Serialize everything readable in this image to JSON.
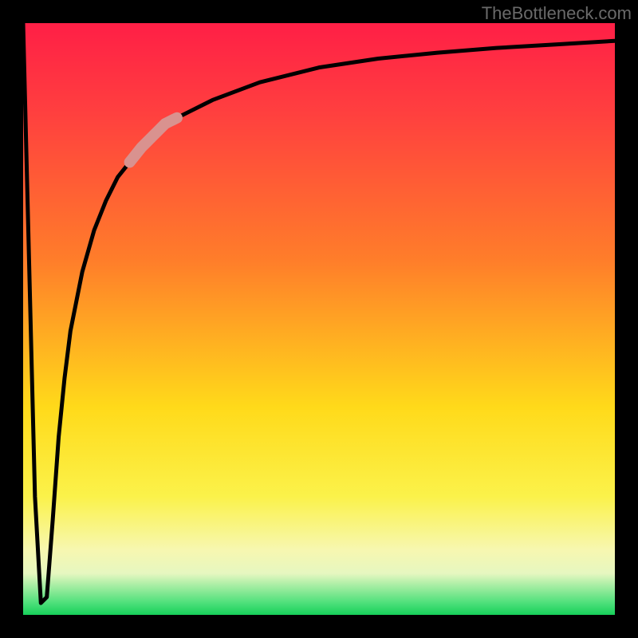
{
  "watermark": "TheBottleneck.com",
  "colors": {
    "frame": "#000000",
    "curve": "#000000",
    "highlight": "#d9928f",
    "gradient_top": "#ff1f46",
    "gradient_bottom": "#17d05a"
  },
  "chart_data": {
    "type": "line",
    "title": "",
    "xlabel": "",
    "ylabel": "",
    "xlim": [
      0,
      100
    ],
    "ylim": [
      0,
      100
    ],
    "grid": false,
    "legend": false,
    "series": [
      {
        "name": "bottleneck-curve",
        "x": [
          0,
          1,
          2,
          3,
          4,
          5,
          6,
          7,
          8,
          10,
          12,
          14,
          16,
          20,
          24,
          28,
          32,
          40,
          50,
          60,
          70,
          80,
          90,
          100
        ],
        "y": [
          100,
          60,
          20,
          2,
          3,
          16,
          30,
          40,
          48,
          58,
          65,
          70,
          74,
          79,
          83,
          85,
          87,
          90,
          92.5,
          94,
          95,
          95.8,
          96.4,
          97
        ]
      }
    ],
    "highlight_segment": {
      "series": "bottleneck-curve",
      "x_start": 18,
      "x_end": 26
    }
  }
}
